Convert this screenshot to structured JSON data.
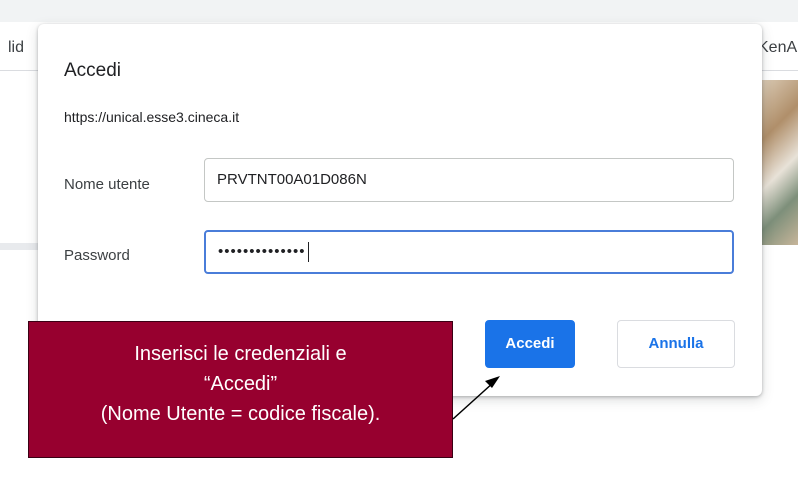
{
  "background": {
    "tab_text_left": "lid",
    "tab_text_right": "KenA"
  },
  "dialog": {
    "title": "Accedi",
    "url": "https://unical.esse3.cineca.it",
    "username_label": "Nome utente",
    "username_value": "PRVTNT00A01D086N",
    "password_label": "Password",
    "password_value": "••••••••••••••",
    "submit_label": "Accedi",
    "cancel_label": "Annulla"
  },
  "callout": {
    "lines": [
      "Inserisci le credenziali e",
      "“Accedi”",
      "(Nome Utente = codice fiscale)."
    ]
  },
  "colors": {
    "accent": "#1a73e8",
    "focus_border": "#4a7dd9",
    "callout_bg": "#97002f"
  },
  "icons": {
    "arrow": "arrow-pointer-icon"
  }
}
